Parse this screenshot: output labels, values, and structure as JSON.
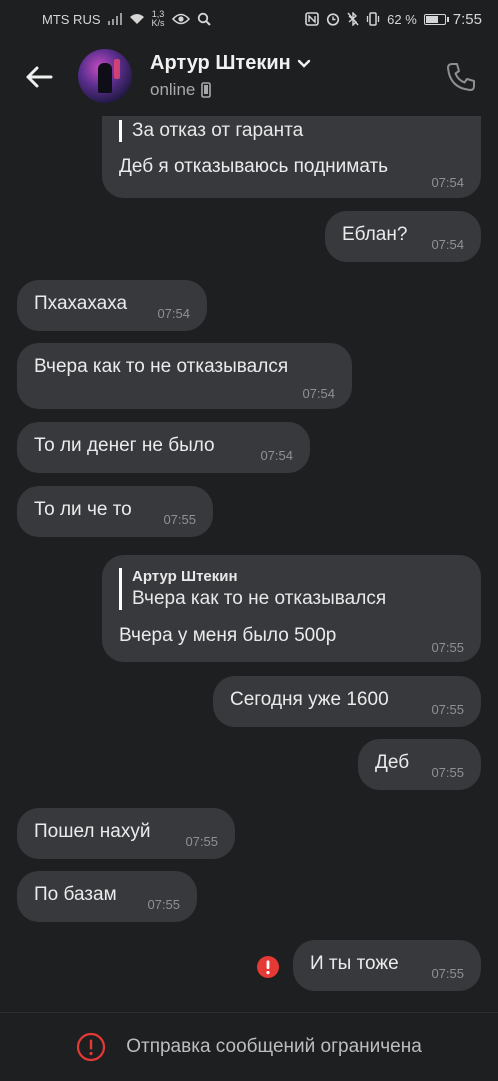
{
  "status_bar": {
    "carrier": "MTS RUS",
    "net_speed": "1,3",
    "net_speed_unit": "K/s",
    "battery": "62 %",
    "battery_level": 0.62,
    "time": "7:55"
  },
  "header": {
    "contact_name": "Артур Штекин",
    "status": "online"
  },
  "messages": [
    {
      "side": "out",
      "quote_text": "За отказ от гаранта",
      "text": "Деб я отказываюсь поднимать",
      "time": "07:54"
    },
    {
      "side": "out",
      "text": "Еблан?",
      "time": "07:54"
    },
    {
      "side": "in",
      "text": "Пхахахаха",
      "time": "07:54"
    },
    {
      "side": "in",
      "text": "Вчера как то не отказывался",
      "time": "07:54"
    },
    {
      "side": "in",
      "text": "То ли денег не было",
      "time": "07:54"
    },
    {
      "side": "in",
      "text": "То ли че то",
      "time": "07:55"
    },
    {
      "side": "out",
      "quote_author": "Артур Штекин",
      "quote_text": "Вчера как то не отказывался",
      "text": "Вчера у меня было 500р",
      "time": "07:55"
    },
    {
      "side": "out",
      "text": "Сегодня уже 1600",
      "time": "07:55"
    },
    {
      "side": "out",
      "text": "Деб",
      "time": "07:55"
    },
    {
      "side": "in",
      "text": "Пошел нахуй",
      "time": "07:55"
    },
    {
      "side": "in",
      "text": "По базам",
      "time": "07:55"
    },
    {
      "side": "out",
      "text": "И ты тоже",
      "time": "07:55",
      "failed": true
    }
  ],
  "footer": {
    "restriction_text": "Отправка сообщений ограничена"
  },
  "colors": {
    "background": "#1e1f21",
    "bubble": "#38393d",
    "error": "#e53935"
  }
}
